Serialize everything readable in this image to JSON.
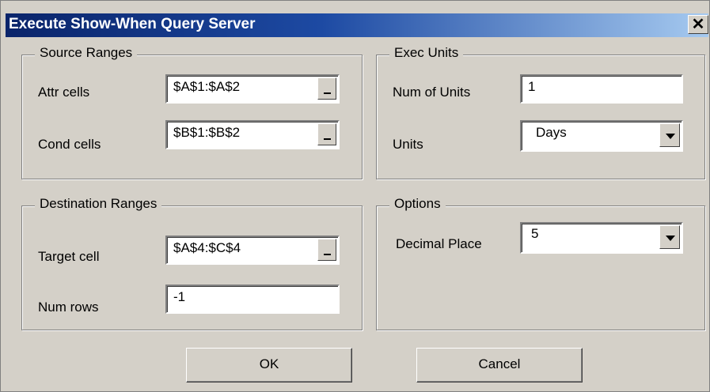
{
  "window": {
    "title": "Execute Show-When Query Server",
    "close_label": "✕"
  },
  "source_ranges": {
    "legend": "Source Ranges",
    "attr_label": "Attr cells",
    "attr_value": "$A$1:$A$2",
    "cond_label": "Cond cells",
    "cond_value": "$B$1:$B$2"
  },
  "exec_units": {
    "legend": "Exec Units",
    "num_units_label": "Num of  Units",
    "num_units_value": "1",
    "units_label": "Units",
    "units_value": "Days"
  },
  "destination_ranges": {
    "legend": "Destination Ranges",
    "target_label": "Target cell",
    "target_value": "$A$4:$C$4",
    "num_rows_label": "Num rows",
    "num_rows_value": "-1"
  },
  "options": {
    "legend": "Options",
    "decimal_label": "Decimal Place",
    "decimal_value": "5"
  },
  "buttons": {
    "ok": "OK",
    "cancel": "Cancel"
  }
}
